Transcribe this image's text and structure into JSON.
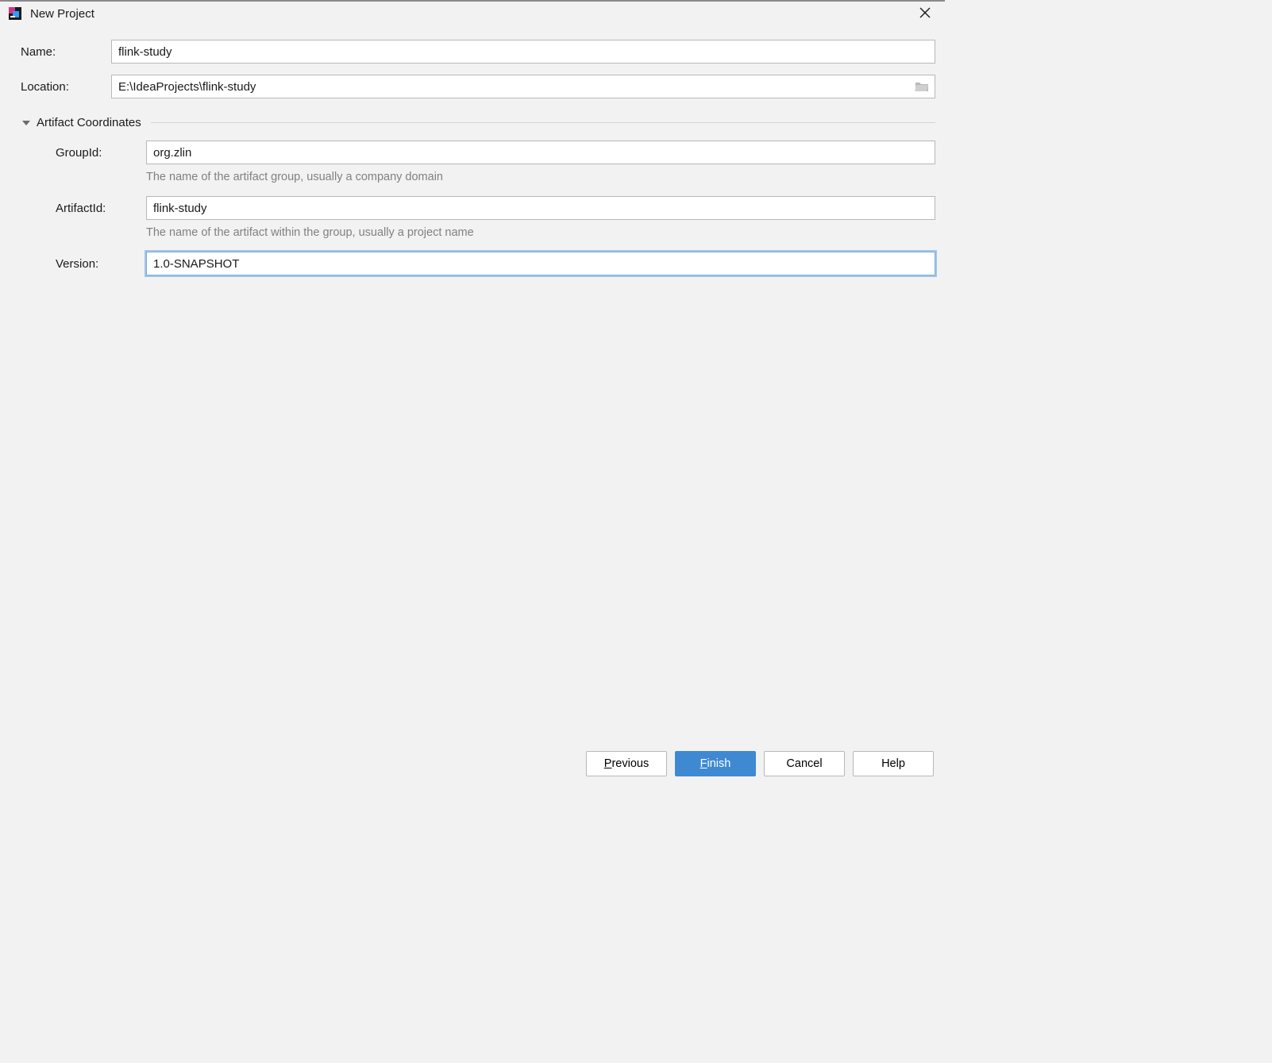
{
  "window": {
    "title": "New Project"
  },
  "form": {
    "name_label": "Name:",
    "name_value": "flink-study",
    "location_label": "Location:",
    "location_value": "E:\\IdeaProjects\\flink-study",
    "section_title": "Artifact Coordinates",
    "group_label": "GroupId:",
    "group_value": "org.zlin",
    "group_hint": "The name of the artifact group, usually a company domain",
    "artifact_label": "ArtifactId:",
    "artifact_value": "flink-study",
    "artifact_hint": "The name of the artifact within the group, usually a project name",
    "version_label": "Version:",
    "version_value": "1.0-SNAPSHOT"
  },
  "buttons": {
    "previous": "Previous",
    "previous_m": "P",
    "finish": "Finish",
    "finish_m": "F",
    "cancel": "Cancel",
    "help": "Help"
  }
}
